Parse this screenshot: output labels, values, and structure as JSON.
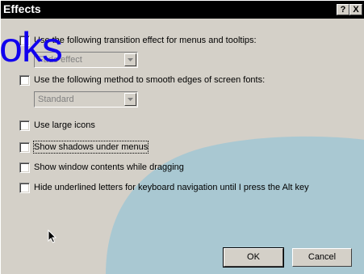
{
  "window": {
    "title": "Effects"
  },
  "title_buttons": {
    "help": "?",
    "close": "X"
  },
  "options": [
    {
      "label": "Use the following transition effect for menus and tooltips:",
      "checked": false,
      "enabled": true
    },
    {
      "label": "Use the following method to smooth edges of screen fonts:",
      "checked": false,
      "enabled": true
    },
    {
      "label": "Use large icons",
      "checked": false,
      "enabled": true
    },
    {
      "label": "Show shadows under menus",
      "checked": false,
      "enabled": true,
      "focused": true
    },
    {
      "label": "Show window contents while dragging",
      "checked": false,
      "enabled": true
    },
    {
      "label": "Hide underlined letters for keyboard navigation until I press the Alt key",
      "checked": false,
      "enabled": false
    }
  ],
  "dropdowns": {
    "transition": {
      "value": "Fade effect",
      "enabled": false
    },
    "smoothing": {
      "value": "Standard",
      "enabled": false
    }
  },
  "buttons": {
    "ok": "OK",
    "cancel": "Cancel"
  },
  "watermark": "oks",
  "colors": {
    "titlebar": "#000000",
    "face": "#d4d0c8",
    "background_shape": "#a9c8d2",
    "watermark": "#1100ee"
  }
}
